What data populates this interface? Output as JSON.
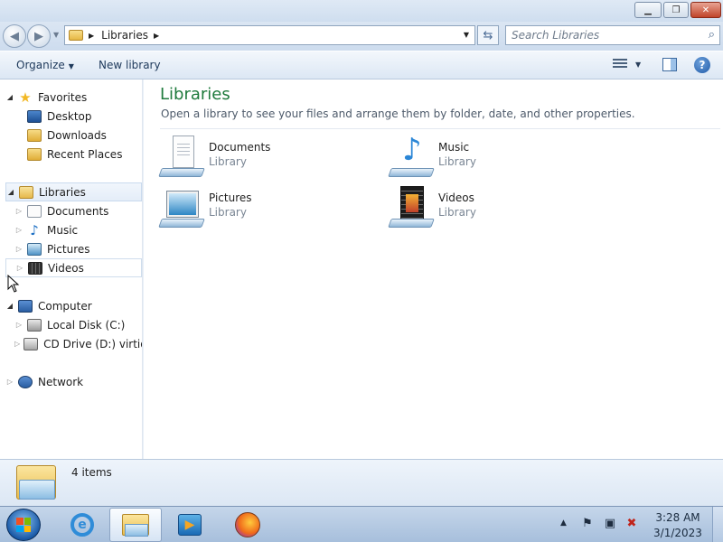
{
  "window": {
    "controls": {
      "minimize_icon": "minimize-icon",
      "maximize_icon": "restore-icon",
      "close_icon": "close-icon"
    }
  },
  "address_bar": {
    "breadcrumb": "Libraries",
    "search_placeholder": "Search Libraries"
  },
  "command_bar": {
    "organize_label": "Organize",
    "new_library_label": "New library"
  },
  "nav_pane": {
    "favorites": {
      "label": "Favorites",
      "items": [
        {
          "label": "Desktop",
          "icon": "desktop-icon"
        },
        {
          "label": "Downloads",
          "icon": "downloads-folder-icon"
        },
        {
          "label": "Recent Places",
          "icon": "recent-places-icon"
        }
      ]
    },
    "libraries": {
      "label": "Libraries",
      "items": [
        {
          "label": "Documents",
          "icon": "documents-icon"
        },
        {
          "label": "Music",
          "icon": "music-icon"
        },
        {
          "label": "Pictures",
          "icon": "pictures-icon"
        },
        {
          "label": "Videos",
          "icon": "videos-icon"
        }
      ]
    },
    "computer": {
      "label": "Computer",
      "items": [
        {
          "label": "Local Disk (C:)",
          "icon": "local-disk-icon"
        },
        {
          "label": "CD Drive (D:) virtio-w",
          "icon": "cd-drive-icon"
        }
      ]
    },
    "network": {
      "label": "Network"
    }
  },
  "content": {
    "title": "Libraries",
    "description": "Open a library to see your files and arrange them by folder, date, and other properties.",
    "libraries": [
      {
        "name": "Documents",
        "type": "Library",
        "icon": "documents-library-icon"
      },
      {
        "name": "Music",
        "type": "Library",
        "icon": "music-library-icon"
      },
      {
        "name": "Pictures",
        "type": "Library",
        "icon": "pictures-library-icon"
      },
      {
        "name": "Videos",
        "type": "Library",
        "icon": "videos-library-icon"
      }
    ]
  },
  "details_pane": {
    "item_count": "4 items"
  },
  "taskbar": {
    "apps": [
      "internet-explorer-icon",
      "windows-explorer-icon",
      "media-player-icon",
      "firefox-icon"
    ],
    "time": "3:28 AM",
    "date": "3/1/2023"
  },
  "colors": {
    "title_green": "#1e7a3c",
    "link_blue": "#1e395b",
    "selection_bg": "#e4edf8"
  }
}
